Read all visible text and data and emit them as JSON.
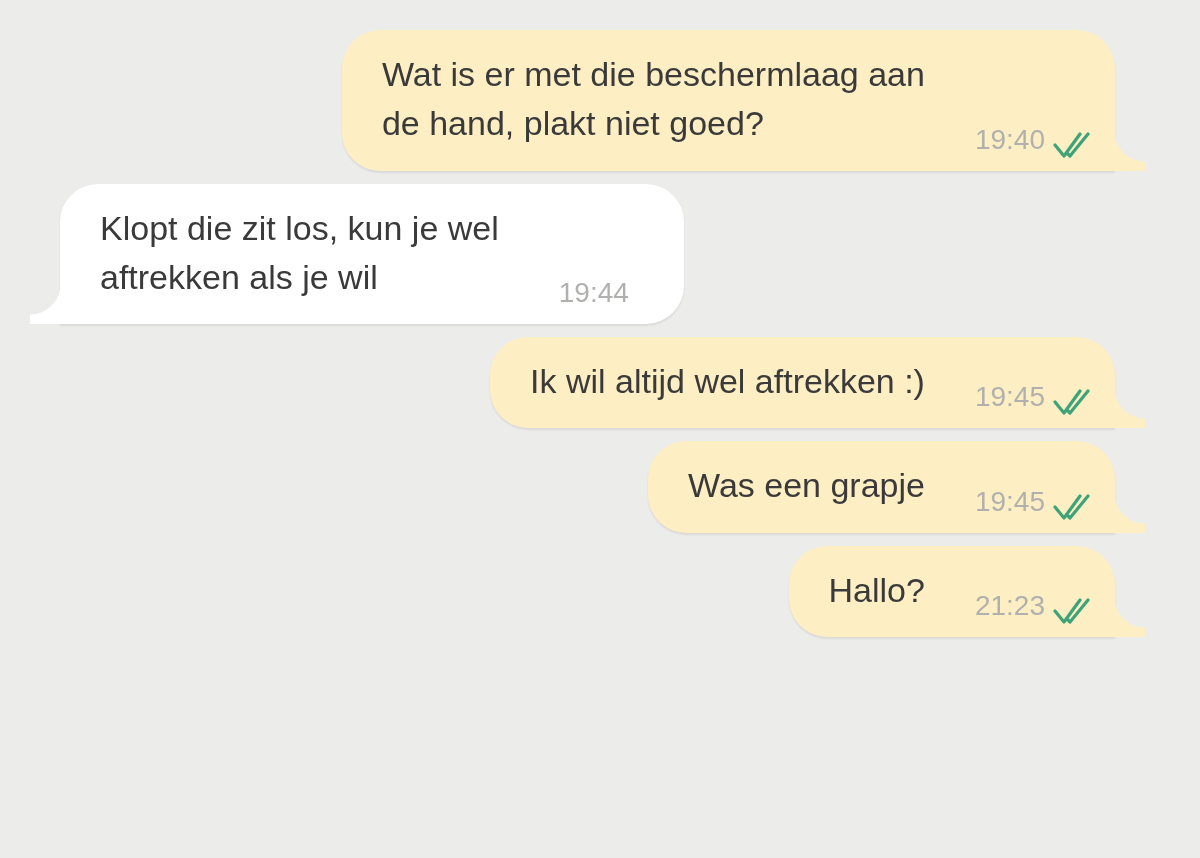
{
  "messages": [
    {
      "outgoing": true,
      "text": "Wat is er met die beschermlaag aan\nde hand, plakt niet goed?",
      "time": "19:40",
      "read": true
    },
    {
      "outgoing": false,
      "text": "Klopt die zit los, kun je wel\naftrekken als je wil",
      "time": "19:44"
    },
    {
      "outgoing": true,
      "text": "Ik wil altijd wel aftrekken :)",
      "time": "19:45",
      "read": true
    },
    {
      "outgoing": true,
      "text": "Was een grapje",
      "time": "19:45",
      "read": true
    },
    {
      "outgoing": true,
      "text": "Hallo?",
      "time": "21:23",
      "read": true
    }
  ]
}
